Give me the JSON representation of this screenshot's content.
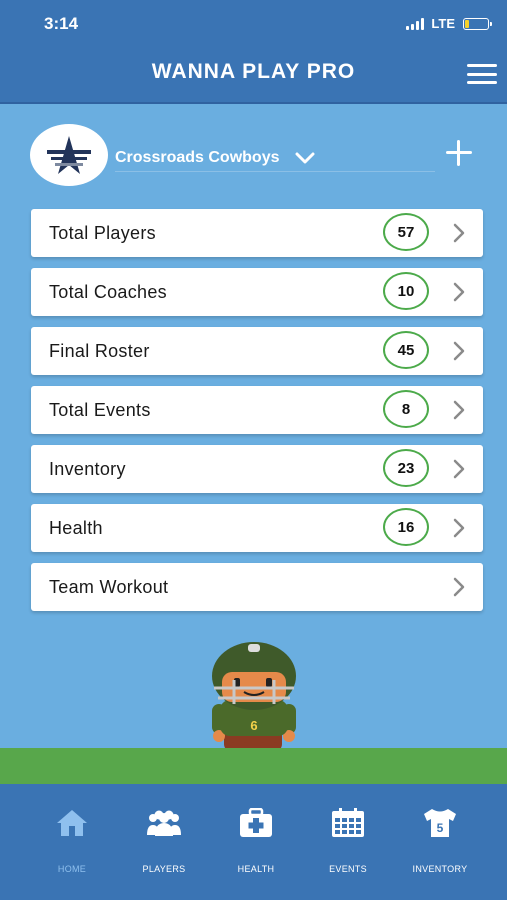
{
  "status_bar": {
    "time": "3:14",
    "network": "LTE",
    "battery_percent": 20
  },
  "header": {
    "title": "WANNA PLAY PRO",
    "menu_icon": "hamburger-menu-icon"
  },
  "team": {
    "name": "Crossroads Cowboys",
    "logo_icon": "star-logo-icon",
    "add_icon": "plus-icon"
  },
  "stats": [
    {
      "label": "Total Players",
      "count": "57"
    },
    {
      "label": "Total Coaches",
      "count": "10"
    },
    {
      "label": "Final Roster",
      "count": "45"
    },
    {
      "label": "Total Events",
      "count": "8"
    },
    {
      "label": "Inventory",
      "count": "23"
    },
    {
      "label": "Health",
      "count": "16"
    },
    {
      "label": "Team Workout",
      "count": null
    }
  ],
  "mascot": {
    "jersey_number": "6"
  },
  "tabs": [
    {
      "label": "HOME",
      "icon": "home-icon",
      "active": true
    },
    {
      "label": "PLAYERS",
      "icon": "players-icon",
      "active": false
    },
    {
      "label": "HEALTH",
      "icon": "first-aid-icon",
      "active": false
    },
    {
      "label": "EVENTS",
      "icon": "calendar-icon",
      "active": false
    },
    {
      "label": "INVENTORY",
      "icon": "jersey-icon",
      "active": false,
      "badge": "5"
    }
  ],
  "colors": {
    "header": "#3a74b4",
    "background": "#6aaee0",
    "count_ring": "#4caa4a",
    "grass": "#58a74b",
    "active_tab": "#8fc0ee",
    "battery": "#f6d22a"
  }
}
